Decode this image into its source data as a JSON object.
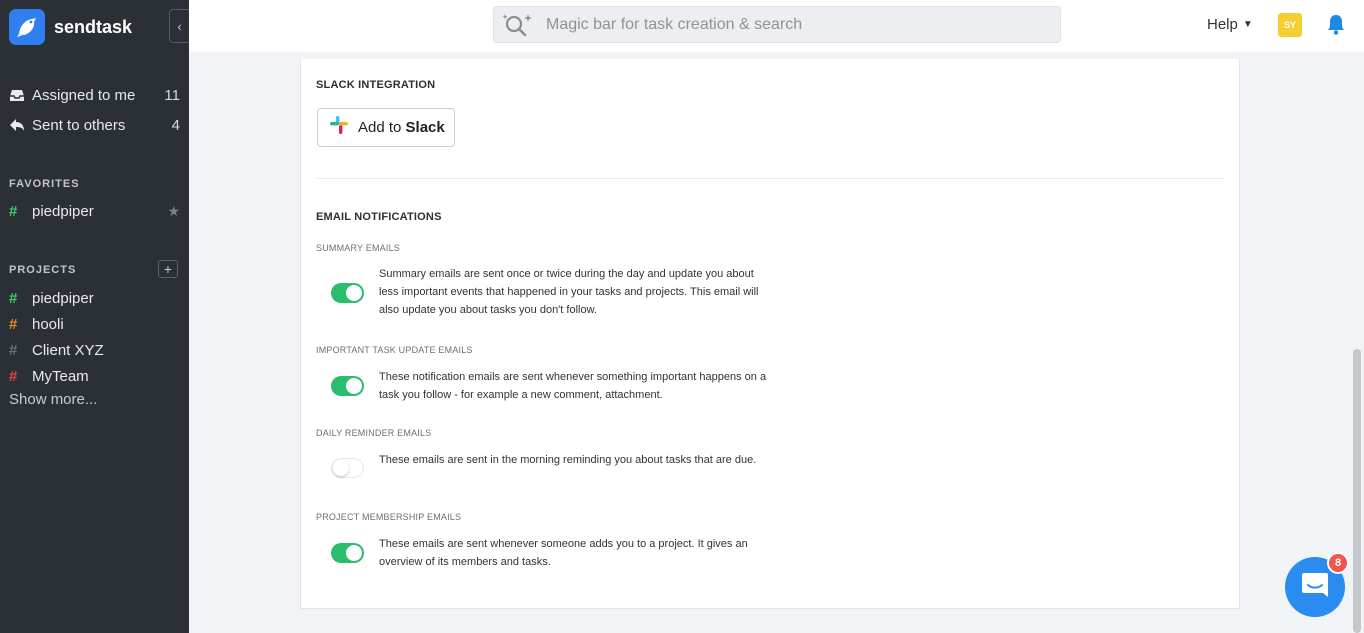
{
  "brand": {
    "name": "sendtask",
    "logo_icon": "bird-logo-icon",
    "accent": "#2f7ff0"
  },
  "sidebar": {
    "inbox": [
      {
        "label": "Assigned to me",
        "count": "11",
        "icon": "inbox-icon"
      },
      {
        "label": "Sent to others",
        "count": "4",
        "icon": "reply-icon"
      }
    ],
    "favorites_title": "FAVORITES",
    "favorites": [
      {
        "label": "piedpiper",
        "hash_color": "#3ecf6e"
      }
    ],
    "projects_title": "PROJECTS",
    "projects": [
      {
        "label": "piedpiper",
        "hash_color": "#3ecf6e"
      },
      {
        "label": "hooli",
        "hash_color": "#f08a24"
      },
      {
        "label": "Client XYZ",
        "hash_color": "#6b7079"
      },
      {
        "label": "MyTeam",
        "hash_color": "#e8443a"
      }
    ],
    "show_more": "Show more..."
  },
  "topbar": {
    "search_placeholder": "Magic bar for task creation & search",
    "help_label": "Help",
    "avatar_initials": "SY",
    "avatar_color": "#f5cf32"
  },
  "slack": {
    "section_title": "SLACK INTEGRATION",
    "button_prefix": "Add to ",
    "button_brand": "Slack"
  },
  "email": {
    "section_title": "EMAIL NOTIFICATIONS",
    "items": [
      {
        "title": "SUMMARY EMAILS",
        "enabled": true,
        "description": "Summary emails are sent once or twice during the day and update you about less important events that happened in your tasks and projects. This email will also update you about tasks you don't follow."
      },
      {
        "title": "IMPORTANT TASK UPDATE EMAILS",
        "enabled": true,
        "description": "These notification emails are sent whenever something important happens on a task you follow - for example a new comment, attachment."
      },
      {
        "title": "DAILY REMINDER EMAILS",
        "enabled": false,
        "description": "These emails are sent in the morning reminding you about tasks that are due."
      },
      {
        "title": "PROJECT MEMBERSHIP EMAILS",
        "enabled": true,
        "description": "These emails are sent whenever someone adds you to a project. It gives an overview of its members and tasks."
      }
    ],
    "toggle_on_color": "#2bbd6e"
  },
  "chat": {
    "badge_count": "8",
    "color": "#2a8cf0"
  }
}
